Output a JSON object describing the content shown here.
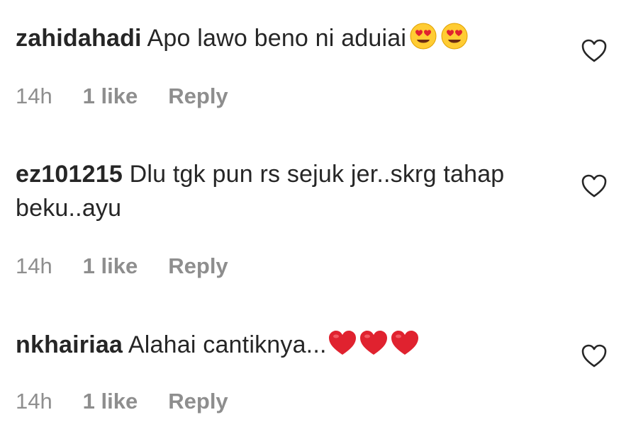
{
  "comments": [
    {
      "username": "zahidahadi",
      "text": "Apo lawo beno ni aduiai",
      "emoji": [
        "heart-eyes-face-icon",
        "heart-eyes-face-icon"
      ],
      "time": "14h",
      "likes": "1 like",
      "reply": "Reply"
    },
    {
      "username": "ez101215",
      "text": "Dlu tgk pun rs sejuk jer..skrg tahap beku..ayu",
      "emoji": [],
      "time": "14h",
      "likes": "1 like",
      "reply": "Reply"
    },
    {
      "username": "nkhairiaa",
      "text": "Alahai cantiknya...",
      "emoji": [
        "red-heart-icon",
        "red-heart-icon",
        "red-heart-icon"
      ],
      "time": "14h",
      "likes": "1 like",
      "reply": "Reply"
    }
  ],
  "colors": {
    "text": "#262626",
    "meta": "#8e8e8e",
    "heart_red": "#e0222f",
    "emoji_face": "#ffcc33"
  }
}
